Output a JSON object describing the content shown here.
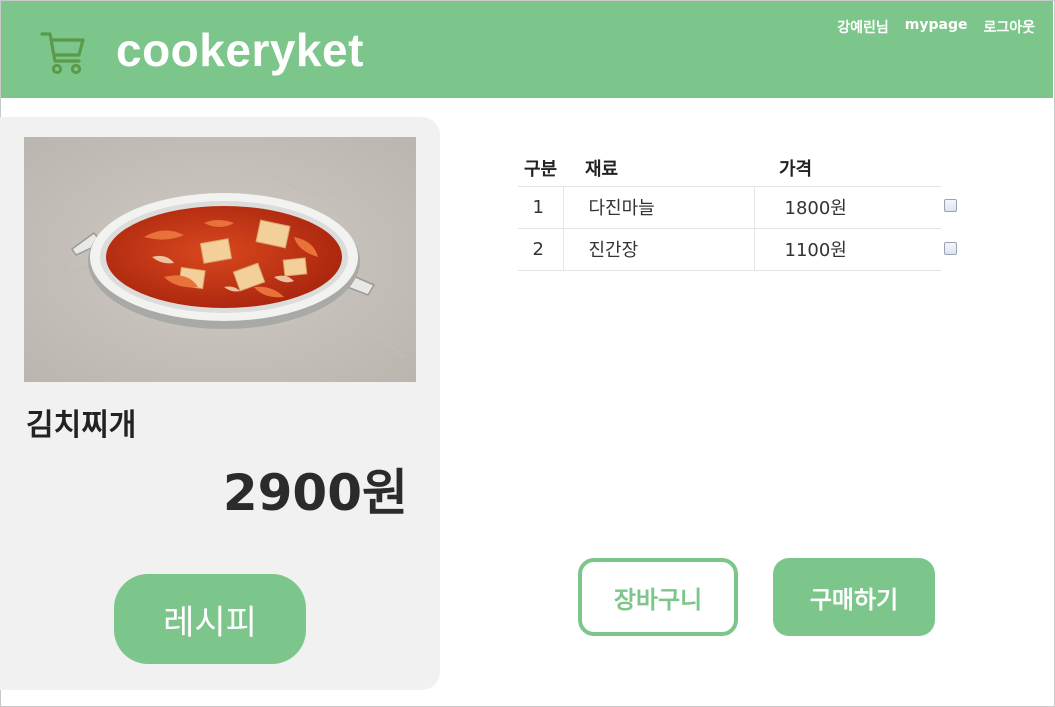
{
  "header": {
    "brand": "cookeryket",
    "user_greeting": "강예린님",
    "mypage_label": "mypage",
    "logout_label": "로그아웃",
    "background_color": "#7dc68b"
  },
  "product": {
    "name": "김치찌개",
    "price": "2900원",
    "recipe_button_label": "레시피",
    "image_alt": "kimchi-stew-image"
  },
  "ingredients": {
    "headers": {
      "no": "구분",
      "name": "재료",
      "price": "가격"
    },
    "rows": [
      {
        "no": "1",
        "name": "다진마늘",
        "price": "1800원",
        "checked": false
      },
      {
        "no": "2",
        "name": "진간장",
        "price": "1100원",
        "checked": false
      }
    ]
  },
  "actions": {
    "cart_label": "장바구니",
    "buy_label": "구매하기"
  },
  "icons": {
    "cart": "shopping-cart-icon",
    "checkbox": "checkbox-icon"
  },
  "colors": {
    "accent": "#7dc68b",
    "card_bg": "#f1f1f1"
  }
}
